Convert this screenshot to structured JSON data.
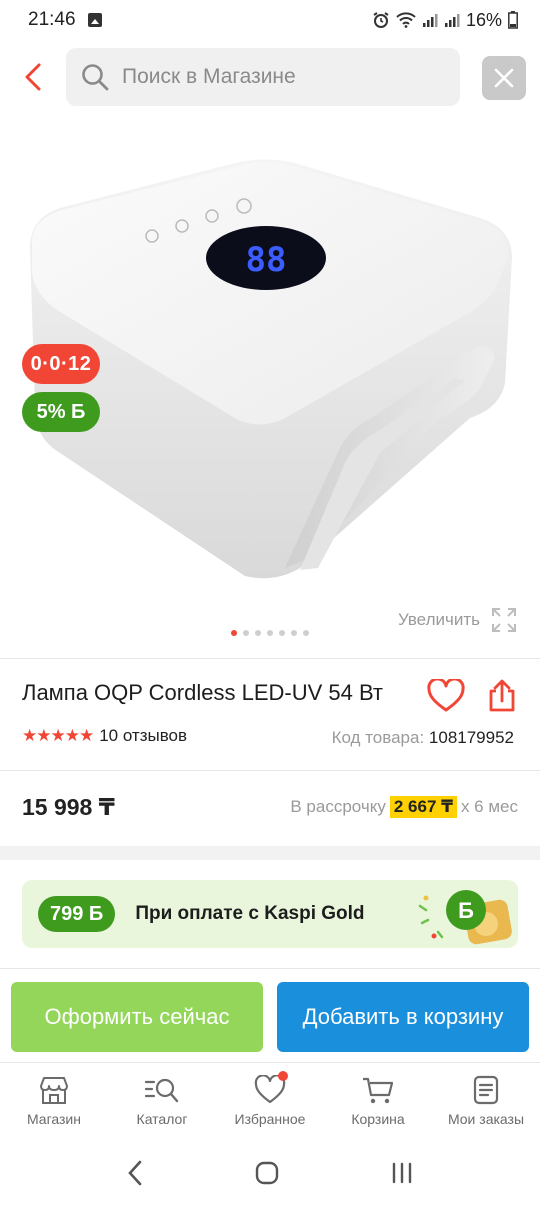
{
  "status_bar": {
    "time": "21:46",
    "battery": "16%"
  },
  "search": {
    "placeholder": "Поиск в Магазине"
  },
  "product_image": {
    "badges": {
      "installment": "0·0·12",
      "bonus": "5% Б"
    },
    "enlarge_label": "Увеличить",
    "gallery_dots": 7,
    "active_dot": 1
  },
  "product": {
    "title": "Лампа OQP Cordless LED-UV 54 Вт",
    "rating": 5,
    "reviews": "10 отзывов",
    "code_label": "Код товара:",
    "code_value": "108179952",
    "price": "15 998 ₸",
    "installment_prefix": "В рассрочку",
    "installment_amount": "2 667 ₸",
    "installment_suffix": "х 6 мес"
  },
  "kaspi_gold": {
    "bonus": "799 Б",
    "text": "При оплате с Kaspi Gold"
  },
  "actions": {
    "checkout": "Оформить сейчас",
    "add_to_cart": "Добавить в корзину"
  },
  "bottom_nav": {
    "items": [
      {
        "label": "Магазин",
        "icon": "shop-icon"
      },
      {
        "label": "Каталог",
        "icon": "catalog-search-icon"
      },
      {
        "label": "Избранное",
        "icon": "heart-icon"
      },
      {
        "label": "Корзина",
        "icon": "cart-icon"
      },
      {
        "label": "Мои заказы",
        "icon": "orders-icon"
      }
    ]
  },
  "colors": {
    "accent_red": "#f14635",
    "kaspi_green": "#3e9b1e",
    "checkout_green": "#93d65a",
    "cart_blue": "#1a8fdb",
    "installment_yellow": "#ffd100"
  }
}
